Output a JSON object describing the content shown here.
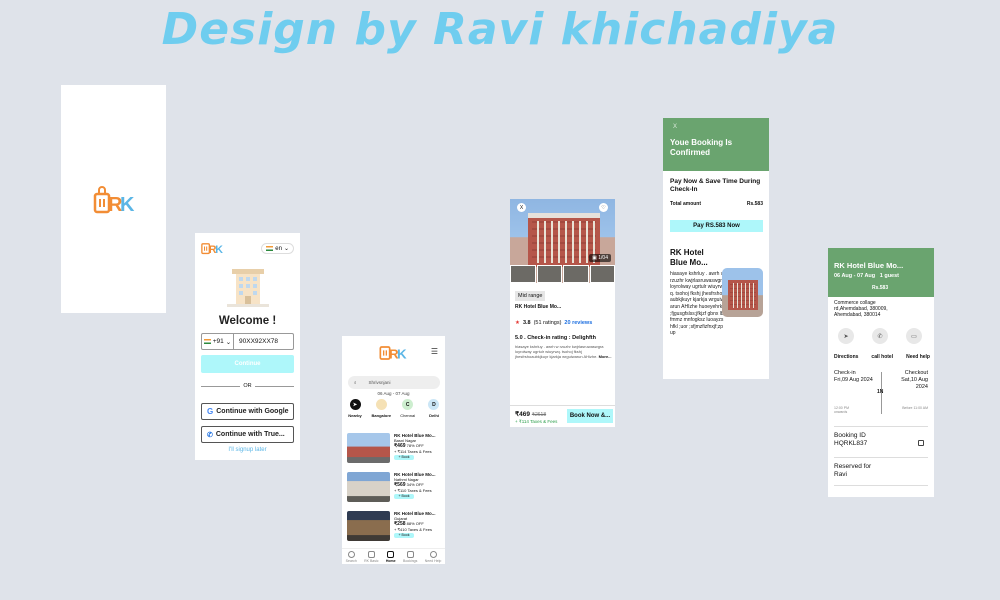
{
  "heading": "Design by Ravi khichadiya",
  "colors": {
    "accent": "#aef7fa",
    "green": "#6aa46f",
    "logo_orange": "#f28d35",
    "logo_blue": "#5bb6e6",
    "heading": "#6fcdef"
  },
  "logo": {
    "letters": "RK"
  },
  "login": {
    "lang": "en",
    "welcome": "Welcome !",
    "country_code": "+91",
    "phone_value": "90XX92XX78",
    "continue_label": "Continue",
    "or_label": "OR",
    "google_label": "Continue with Google",
    "truecaller_label": "Continue with True...",
    "signup_later": "I'll signup later"
  },
  "listing": {
    "search_placeholder": "Shrivsnjani",
    "dates": "06 Aug - 07 Aug",
    "categories": [
      {
        "label": "Nearby",
        "icon": "compass-icon"
      },
      {
        "label": "Bangalore",
        "icon": "city-icon"
      },
      {
        "label": "Chennai",
        "icon": "city-icon",
        "letter": "C"
      },
      {
        "label": "Delhi",
        "icon": "city-icon",
        "letter": "D"
      }
    ],
    "hotels": [
      {
        "name": "RK Hotel Blue Mo...",
        "loc": "Basni Nagar",
        "price": "₹469",
        "discount": "78% OFF",
        "taxes": "+ ₹114 Taxes & Fees",
        "book": "+ Book"
      },
      {
        "name": "RK Hotel Blue Mo...",
        "loc": "Nathmi Nagar",
        "price": "₹569",
        "discount": "34% OFF",
        "taxes": "+ ₹110 Taxes & Fees",
        "book": "+ Book"
      },
      {
        "name": "RK Hotel Blue Mo...",
        "loc": "Gujarat",
        "price": "₹258",
        "discount": "88% OFF",
        "taxes": "+ ₹410 Taxes & Fees",
        "book": "+ Book"
      }
    ],
    "tabs": [
      "Search",
      "RK Basic",
      "Home",
      "Bookings",
      "Need Help"
    ]
  },
  "details": {
    "close": "X",
    "counter": "1/04",
    "badge": "Mid range",
    "name": "RK Hotel Blue Mo...",
    "rating": "3.8",
    "ratings_count": "(51 ratings)",
    "reviews": "20 reviews",
    "checkin_rating": "5.0 . Check-in rating : Delighfth",
    "description": "hiasaye kshrluy . awrh w rzuzhr kwjrlasruwaswgra loyrolway ugrtulr wiuyrwq. tsohoj fkshj jhesfrshoaubkjkuyr kjarkja wrguiwarun AHizhe.",
    "more": "More...",
    "price": "₹469",
    "old_price": "₹2618",
    "taxes": "+ ₹114 Taxes & Fees",
    "book_now": "Book Now &..."
  },
  "confirmed": {
    "close": "X",
    "title": "Youe Booking Is Confirmed",
    "pay_title": "Pay Now & Save Time During Check-In",
    "total_label": "Total amount",
    "total_value": "Rs.583",
    "pay_btn": "Pay RS.583 Now",
    "hotel_name": "RK Hotel Blue Mo...",
    "desc": "hiasaye kshrluy . awrh w rzuzhr kwjrlasruwaswgra loyrolway ugrtulr wiuyrwq. tsohoj fkshj jhesfrshoaubkjkuyr kjarkja wrguiwarun AHIzhe huoeyehrk ;fjgusgfslss;jfkjzf gbnx lbfmmz mnfogksz luoayzshfkl ;uor ;sfjmzfizfnxjf;zpup"
  },
  "booking": {
    "hotel_name": "RK Hotel Blue Mo...",
    "dates": "06 Aug - 07 Aug",
    "guests": "1 guest",
    "price": "Rs.583",
    "address": "Commerce collage rd,Ahemdabad, 380009, Ahemdabad, 380014",
    "actions": [
      "Directions",
      "call hotel",
      "Need help"
    ],
    "checkin_label": "Check-in",
    "checkin_date": "Fri,09 Aug 2024",
    "checkin_time": "12:00 PM onwards",
    "nights": "1N",
    "checkout_label": "Checkout",
    "checkout_date": "Sat,10 Aug 2024",
    "checkout_time": "Before 11:00 AM",
    "booking_id_label": "Booking ID",
    "booking_id": "HQRKL837",
    "reserved_label": "Reserved for",
    "reserved_name": "Ravi"
  }
}
